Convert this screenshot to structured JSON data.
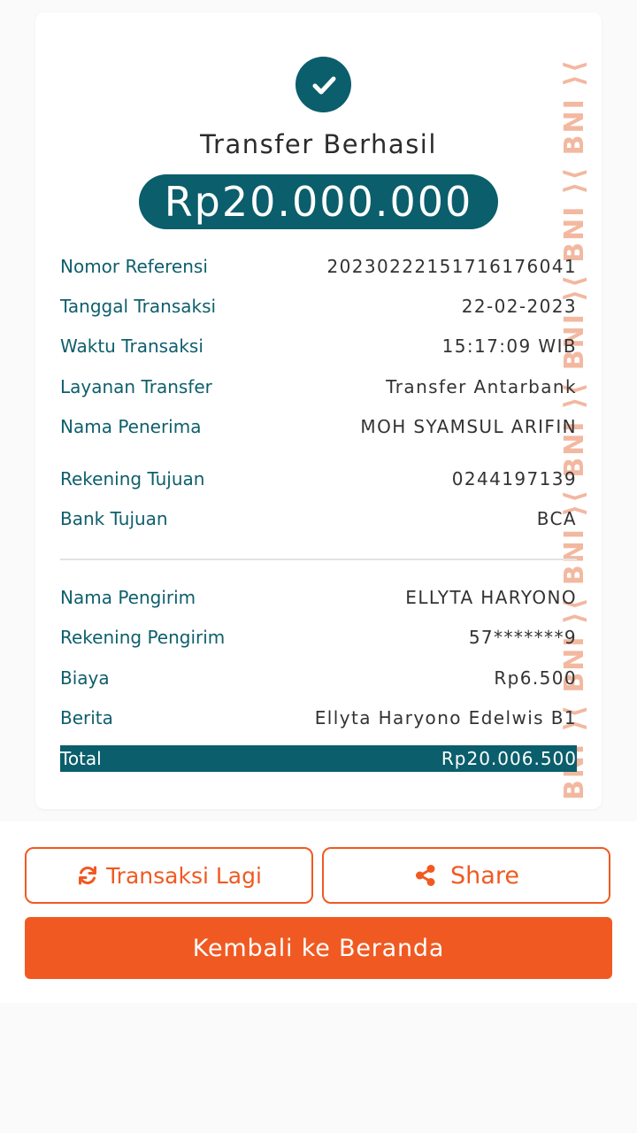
{
  "header": {
    "title": "Transfer Berhasil",
    "amount": "Rp20.000.000"
  },
  "details": [
    {
      "label": "Nomor Referensi",
      "value": "20230222151716176041"
    },
    {
      "label": "Tanggal Transaksi",
      "value": "22-02-2023"
    },
    {
      "label": "Waktu Transaksi",
      "value": "15:17:09 WIB"
    },
    {
      "label": "Layanan Transfer",
      "value": "Transfer Antarbank"
    },
    {
      "label": "Nama Penerima",
      "value": "MOH SYAMSUL ARIFIN"
    },
    {
      "label": "Rekening Tujuan",
      "value": "0244197139"
    },
    {
      "label": "Bank Tujuan",
      "value": "BCA"
    }
  ],
  "sender": [
    {
      "label": "Nama Pengirim",
      "value": "ELLYTA HARYONO"
    },
    {
      "label": "Rekening Pengirim",
      "value": "57*******9"
    },
    {
      "label": "Biaya",
      "value": "Rp6.500"
    },
    {
      "label": "Berita",
      "value": "Ellyta Haryono Edelwis B1"
    }
  ],
  "total": {
    "label": "Total",
    "value": "Rp20.006.500"
  },
  "watermark": "BNI ⟩⟨ BNI ⟩⟨ BNI ⟩⟨ BNI ⟩⟨ BNI ⟩⟨ BNI ⟩⟨ BNI ⟩⟨ BNI ⟩⟨ BNI ⟩⟨ BNI ⟩⟨ BNI",
  "actions": {
    "repeat_label": "Transaksi Lagi",
    "share_label": "Share",
    "home_label": "Kembali ke Beranda"
  },
  "icons": {
    "success": "check-icon",
    "repeat": "refresh-icon",
    "share": "share-icon"
  },
  "colors": {
    "primary_teal": "#0b5e6b",
    "accent_orange": "#f05a22",
    "watermark": "#f2b8a0"
  }
}
